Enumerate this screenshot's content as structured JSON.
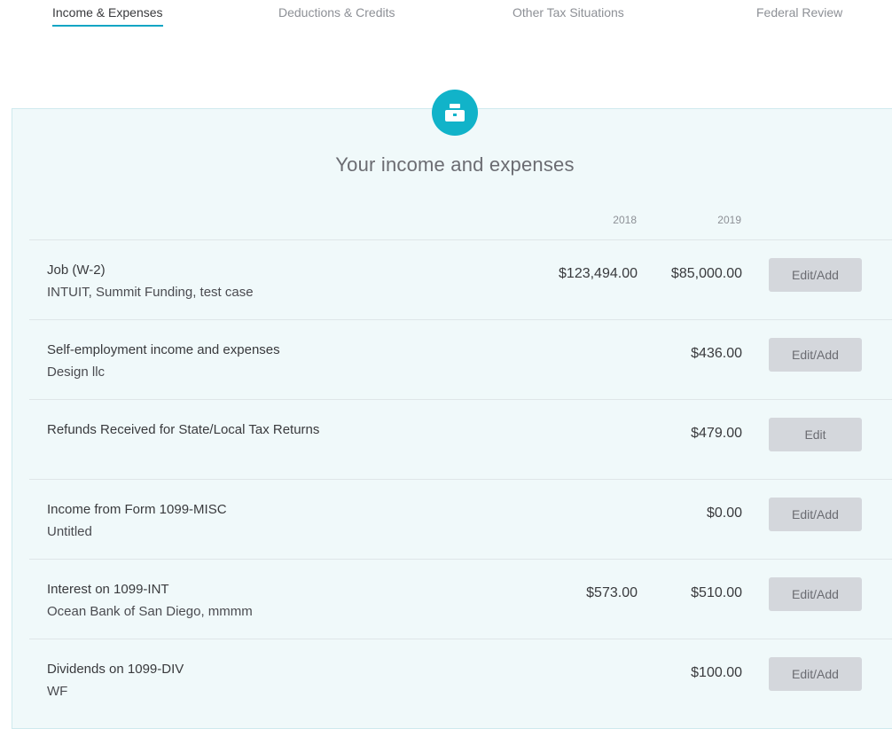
{
  "tabs": [
    {
      "label": "Income & Expenses",
      "active": true
    },
    {
      "label": "Deductions & Credits",
      "active": false
    },
    {
      "label": "Other Tax Situations",
      "active": false
    },
    {
      "label": "Federal Review",
      "active": false
    }
  ],
  "header": {
    "icon": "cash-register-icon",
    "title": "Your income and expenses",
    "year_cols": [
      "2018",
      "2019"
    ]
  },
  "rows": [
    {
      "title": "Job (W-2)",
      "subtitle": "INTUIT, Summit Funding, test case",
      "amount_2018": "$123,494.00",
      "amount_2019": "$85,000.00",
      "action": "Edit/Add"
    },
    {
      "title": "Self-employment income and expenses",
      "subtitle": "Design llc",
      "amount_2018": "",
      "amount_2019": "$436.00",
      "action": "Edit/Add"
    },
    {
      "title": "Refunds Received for State/Local Tax Returns",
      "subtitle": "",
      "amount_2018": "",
      "amount_2019": "$479.00",
      "action": "Edit"
    },
    {
      "title": "Income from Form 1099-MISC",
      "subtitle": "Untitled",
      "amount_2018": "",
      "amount_2019": "$0.00",
      "action": "Edit/Add"
    },
    {
      "title": "Interest on 1099-INT",
      "subtitle": "Ocean Bank of San Diego, mmmm",
      "amount_2018": "$573.00",
      "amount_2019": "$510.00",
      "action": "Edit/Add"
    },
    {
      "title": "Dividends on 1099-DIV",
      "subtitle": "WF",
      "amount_2018": "",
      "amount_2019": "$100.00",
      "action": "Edit/Add"
    }
  ],
  "colors": {
    "accent": "#11b3c9",
    "tab_underline": "#0ea5c4",
    "panel_bg": "#f0f9fa",
    "button_bg": "#d4d7dc"
  }
}
